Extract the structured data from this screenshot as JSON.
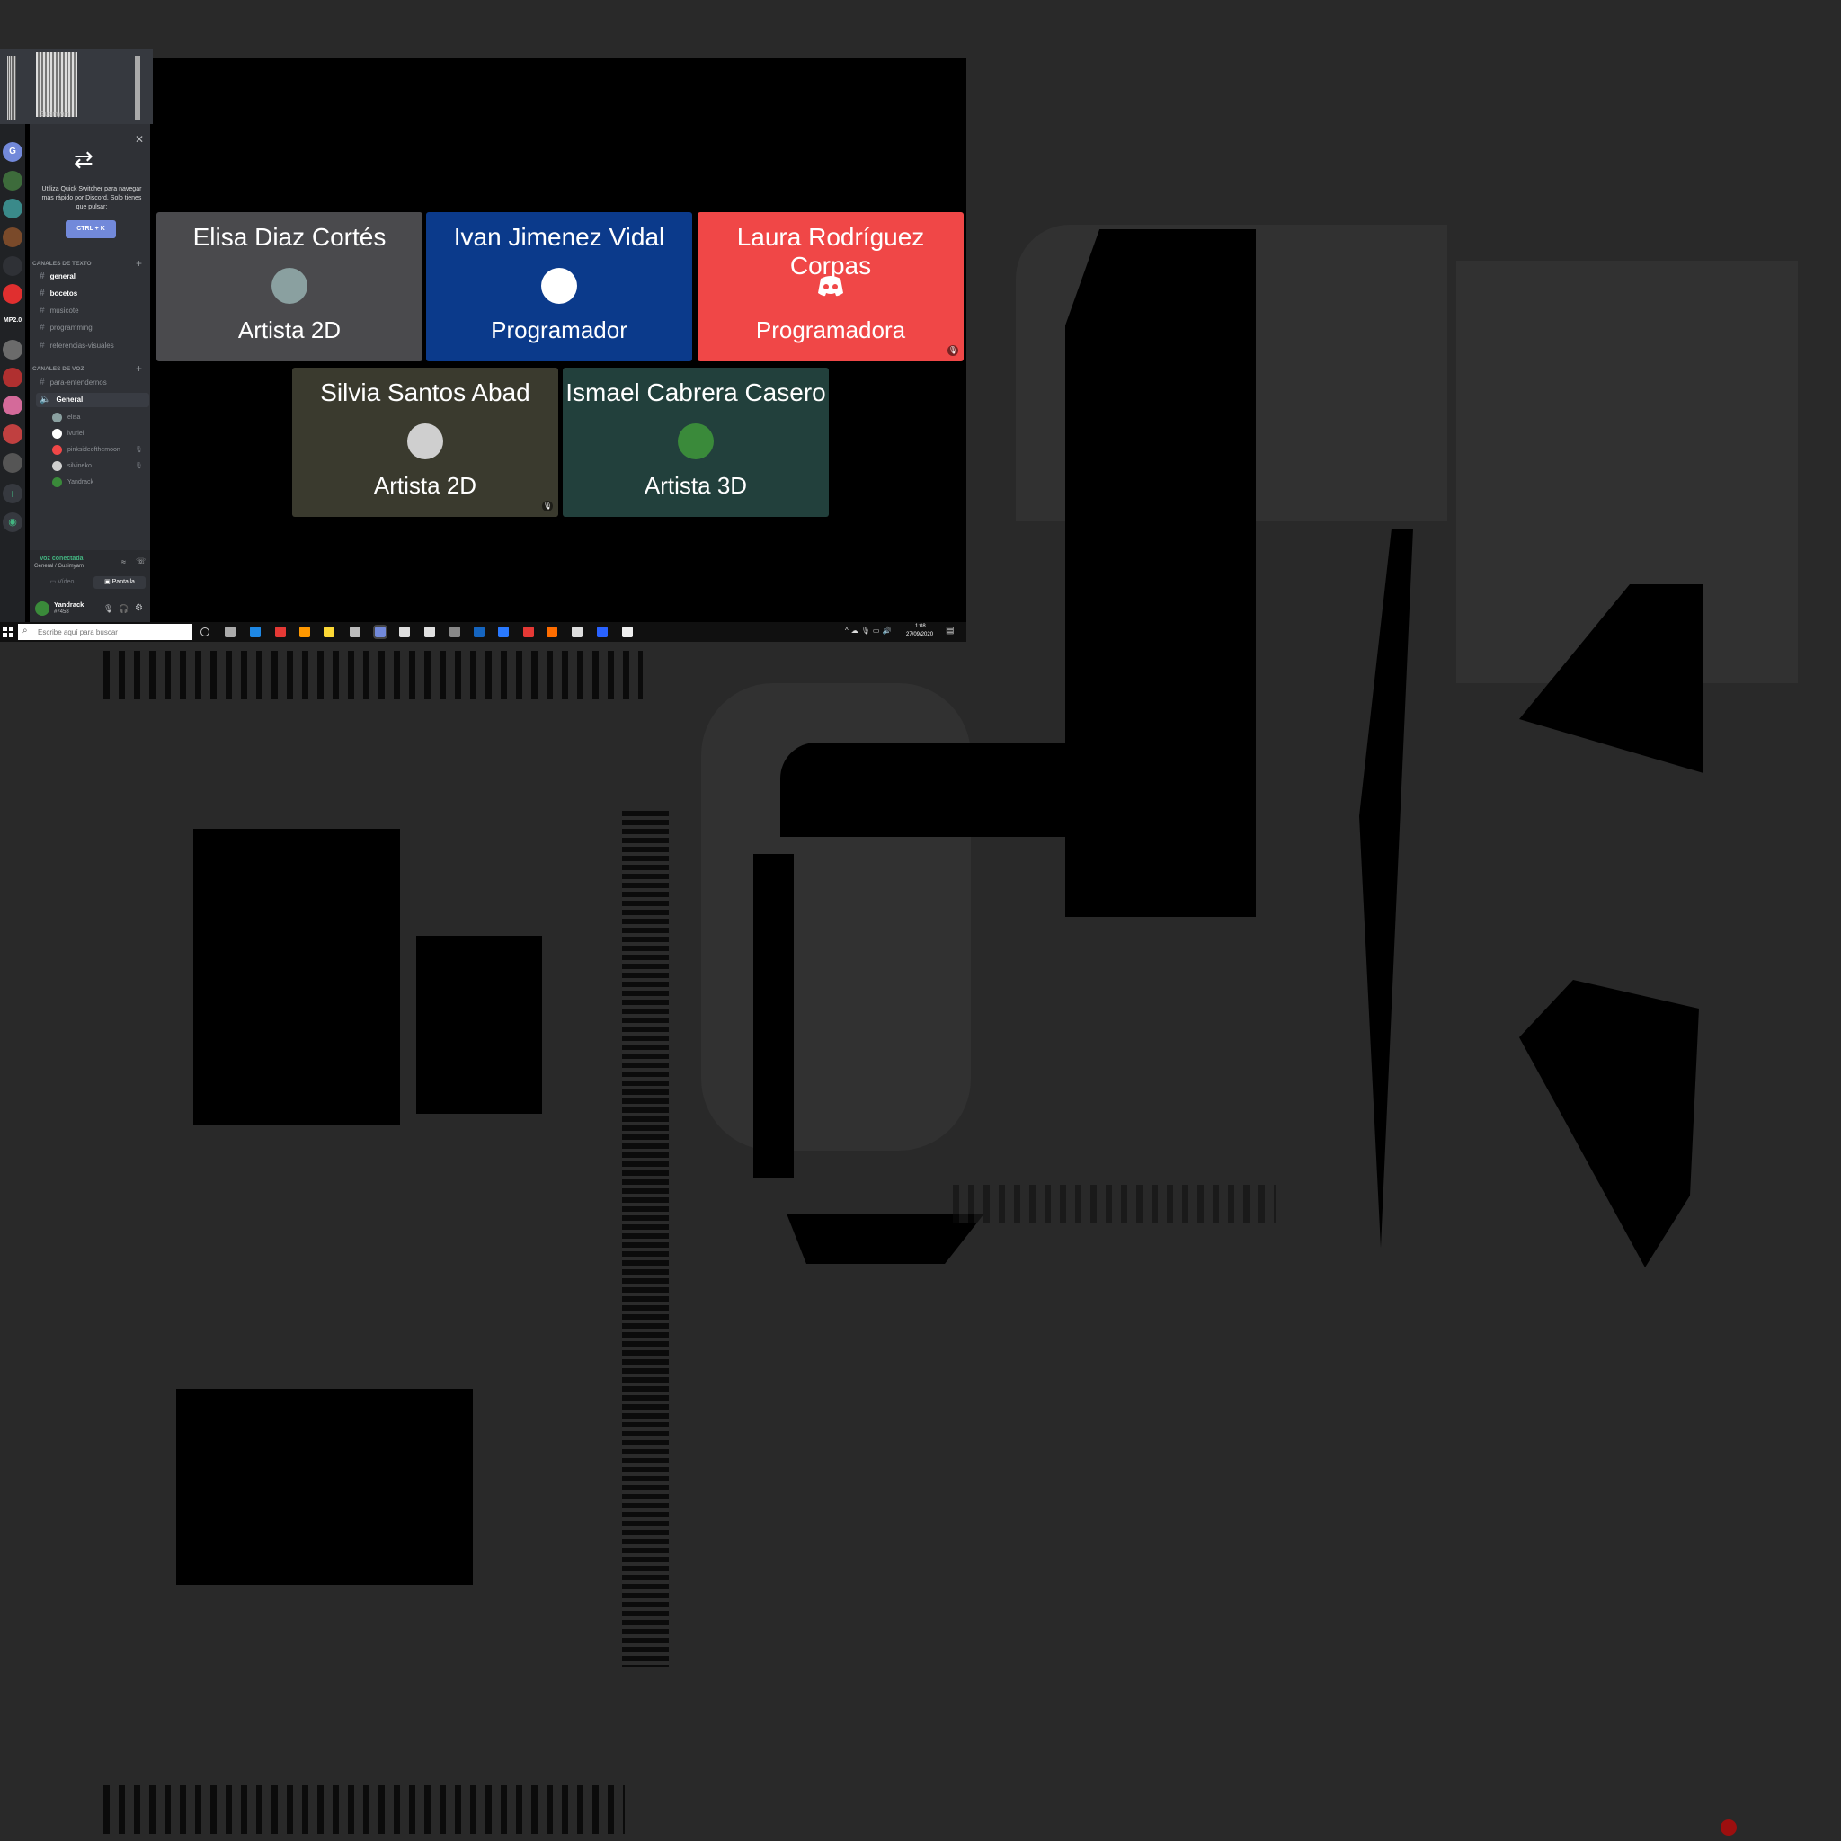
{
  "window": {
    "server_name": "Gusimyam"
  },
  "quick_switcher": {
    "text": "Utiliza Quick Switcher para navegar más rápido por Discord. Solo tienes que pulsar:",
    "shortcut": "CTRL + K",
    "close_icon": "close-icon",
    "arrows_icon": "swap-arrows-icon"
  },
  "servers": [
    {
      "label": "G",
      "color": "#7289da"
    },
    {
      "label": "",
      "color": "#3d6b3b"
    },
    {
      "label": "",
      "color": "#3a8a8a"
    },
    {
      "label": "",
      "color": "#7a4a2a"
    },
    {
      "label": "",
      "color": "#2f3136"
    },
    {
      "label": "",
      "color": "#e02f2f"
    },
    {
      "label": "MP2.0",
      "color": "#202225"
    },
    {
      "label": "",
      "color": "#6b6b6b"
    },
    {
      "label": "",
      "color": "#b03030"
    },
    {
      "label": "",
      "color": "#d46a9a"
    },
    {
      "label": "",
      "color": "#c04040"
    },
    {
      "label": "",
      "color": "#555555"
    }
  ],
  "text_channels": {
    "header": "CANALES DE TEXTO",
    "items": [
      "general",
      "bocetos",
      "musicote",
      "programming",
      "referencias-visuales"
    ]
  },
  "voice_channels": {
    "header": "CANALES DE VOZ",
    "items": [
      "para-entendernos",
      "General"
    ],
    "connected_users": [
      "elisa",
      "ivuriel",
      "pinksideofthemoon",
      "silvineko",
      "Yandrack"
    ]
  },
  "voice_panel": {
    "status": "Voz conectada",
    "location": "General / Gusimyam",
    "video_label": "Vídeo",
    "screen_label": "Pantalla"
  },
  "user_panel": {
    "name": "Yandrack",
    "tag": "#7458"
  },
  "participants": [
    {
      "name": "Elisa Diaz Cortés",
      "role": "Artista 2D",
      "bg": "#4a4a4d",
      "avatar": "#8aa0a0"
    },
    {
      "name": "Ivan Jimenez Vidal",
      "role": "Programador",
      "bg": "#0b3a8b",
      "avatar": "#ffffff"
    },
    {
      "name": "Laura Rodríguez Corpas",
      "role": "Programadora",
      "bg": "#f04747",
      "avatar": "#f04747"
    },
    {
      "name": "Silvia Santos Abad",
      "role": "Artista 2D",
      "bg": "#3a3a2e",
      "avatar": "#cfcfcf"
    },
    {
      "name": "Ismael Cabrera Casero",
      "role": "Artista 3D",
      "bg": "#22403c",
      "avatar": "#3a8a3a"
    }
  ],
  "taskbar": {
    "search_placeholder": "Escribe aquí para buscar",
    "time": "1:08",
    "date": "27/09/2020"
  },
  "colors": {
    "discord_blurple": "#7289da",
    "voice_green": "#43b581"
  }
}
